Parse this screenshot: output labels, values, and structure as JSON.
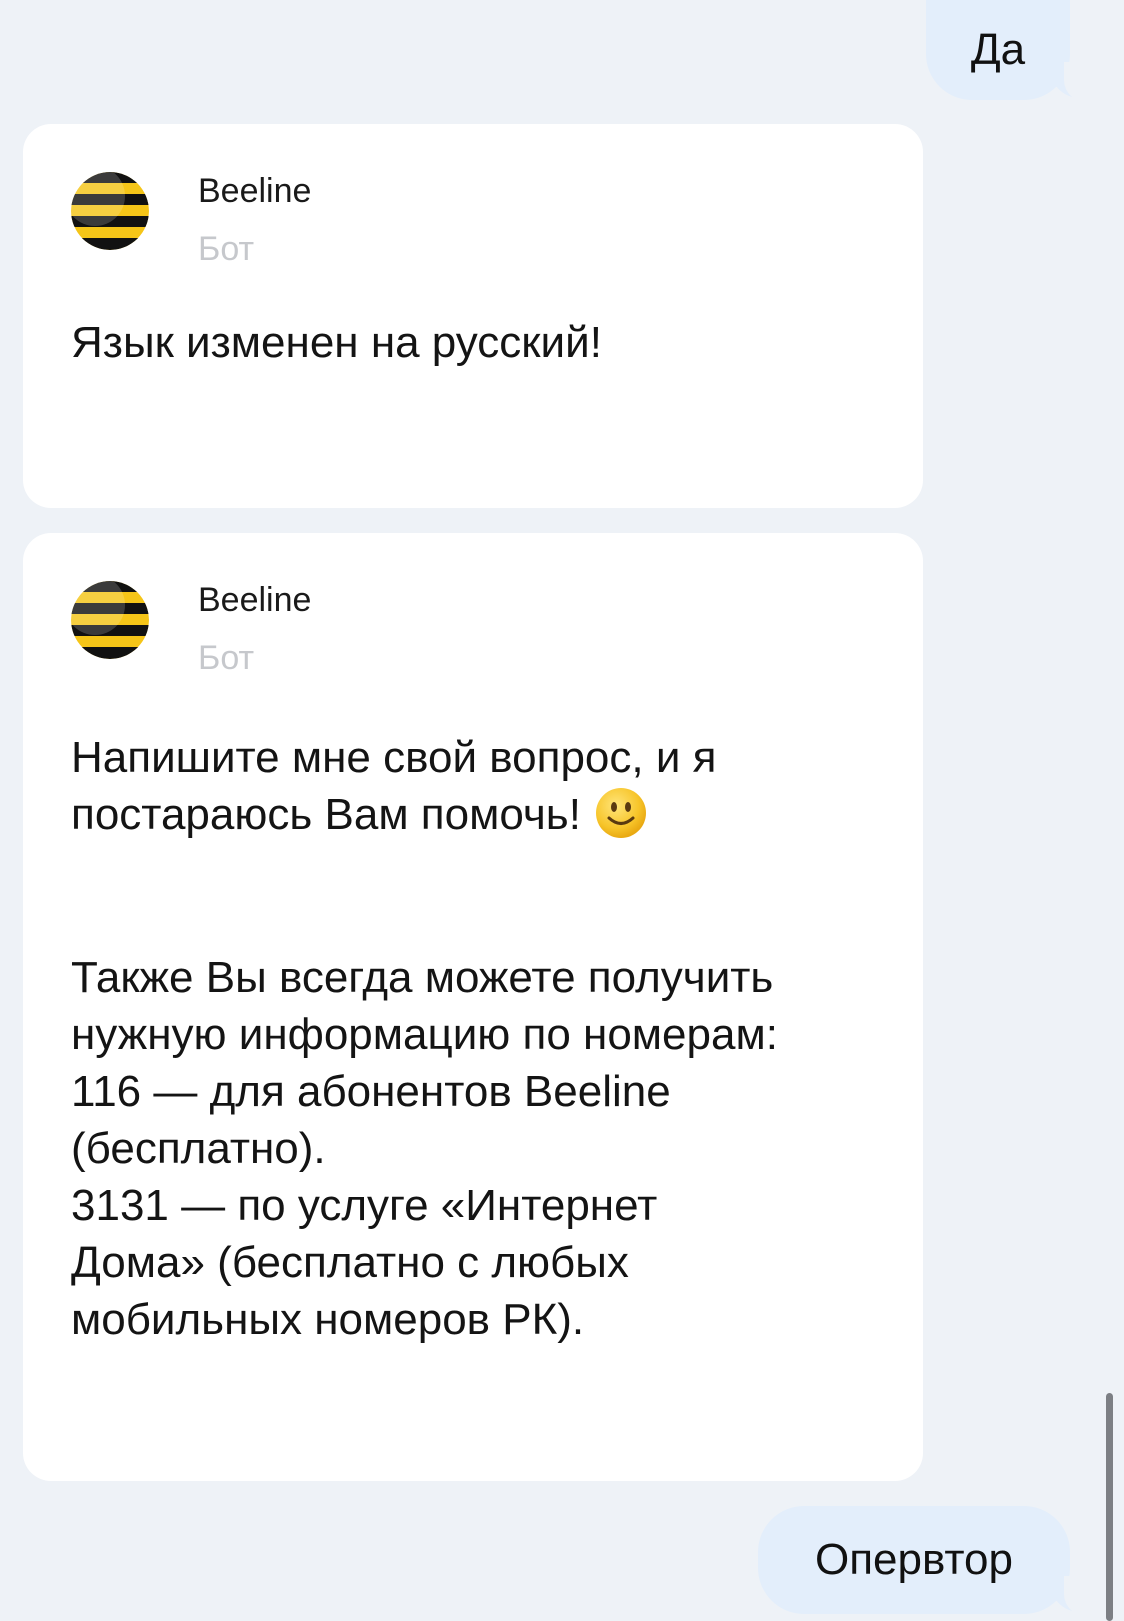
{
  "messages": {
    "outgoing_1": "Да",
    "outgoing_2": "Опервтор",
    "bot_1": {
      "sender": "Beeline",
      "role": "Бот",
      "text": "Язык изменен на русский!"
    },
    "bot_2": {
      "sender": "Beeline",
      "role": "Бот",
      "text_1": "Напишите мне свой вопрос, и я\nпостараюсь Вам помочь!",
      "emoji": "smiling-face-icon",
      "text_2": "Также Вы всегда можете получить\nнужную информацию по номерам:\n116 — для абонентов Beeline\n(бесплатно).\n3131 — по услуге «Интернет\nДома» (бесплатно с любых\nмобильных номеров РК)."
    }
  },
  "colors": {
    "background": "#eef2f7",
    "outgoing_bubble": "#e3eefb",
    "card": "#ffffff",
    "brand_yellow": "#f5c518",
    "brand_black": "#111111",
    "muted_text": "#c6c8cc"
  },
  "icons": {
    "avatar": "beeline-logo-icon"
  }
}
